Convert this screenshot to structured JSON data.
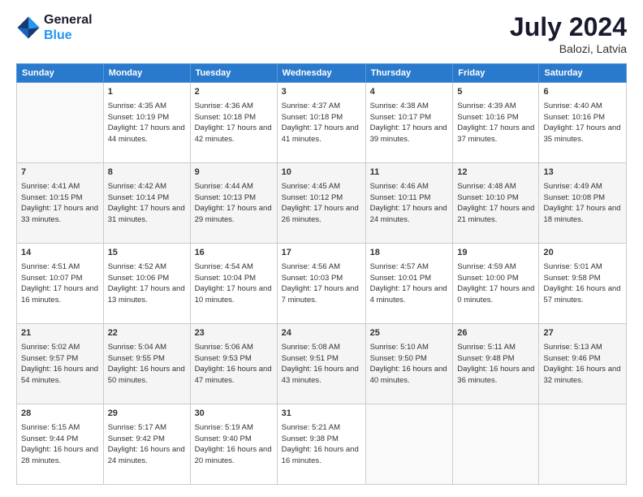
{
  "header": {
    "logo_line1": "General",
    "logo_line2": "Blue",
    "month_title": "July 2024",
    "location": "Balozi, Latvia"
  },
  "days_of_week": [
    "Sunday",
    "Monday",
    "Tuesday",
    "Wednesday",
    "Thursday",
    "Friday",
    "Saturday"
  ],
  "weeks": [
    [
      {
        "day": "",
        "sunrise": "",
        "sunset": "",
        "daylight": ""
      },
      {
        "day": "1",
        "sunrise": "Sunrise: 4:35 AM",
        "sunset": "Sunset: 10:19 PM",
        "daylight": "Daylight: 17 hours and 44 minutes."
      },
      {
        "day": "2",
        "sunrise": "Sunrise: 4:36 AM",
        "sunset": "Sunset: 10:18 PM",
        "daylight": "Daylight: 17 hours and 42 minutes."
      },
      {
        "day": "3",
        "sunrise": "Sunrise: 4:37 AM",
        "sunset": "Sunset: 10:18 PM",
        "daylight": "Daylight: 17 hours and 41 minutes."
      },
      {
        "day": "4",
        "sunrise": "Sunrise: 4:38 AM",
        "sunset": "Sunset: 10:17 PM",
        "daylight": "Daylight: 17 hours and 39 minutes."
      },
      {
        "day": "5",
        "sunrise": "Sunrise: 4:39 AM",
        "sunset": "Sunset: 10:16 PM",
        "daylight": "Daylight: 17 hours and 37 minutes."
      },
      {
        "day": "6",
        "sunrise": "Sunrise: 4:40 AM",
        "sunset": "Sunset: 10:16 PM",
        "daylight": "Daylight: 17 hours and 35 minutes."
      }
    ],
    [
      {
        "day": "7",
        "sunrise": "Sunrise: 4:41 AM",
        "sunset": "Sunset: 10:15 PM",
        "daylight": "Daylight: 17 hours and 33 minutes."
      },
      {
        "day": "8",
        "sunrise": "Sunrise: 4:42 AM",
        "sunset": "Sunset: 10:14 PM",
        "daylight": "Daylight: 17 hours and 31 minutes."
      },
      {
        "day": "9",
        "sunrise": "Sunrise: 4:44 AM",
        "sunset": "Sunset: 10:13 PM",
        "daylight": "Daylight: 17 hours and 29 minutes."
      },
      {
        "day": "10",
        "sunrise": "Sunrise: 4:45 AM",
        "sunset": "Sunset: 10:12 PM",
        "daylight": "Daylight: 17 hours and 26 minutes."
      },
      {
        "day": "11",
        "sunrise": "Sunrise: 4:46 AM",
        "sunset": "Sunset: 10:11 PM",
        "daylight": "Daylight: 17 hours and 24 minutes."
      },
      {
        "day": "12",
        "sunrise": "Sunrise: 4:48 AM",
        "sunset": "Sunset: 10:10 PM",
        "daylight": "Daylight: 17 hours and 21 minutes."
      },
      {
        "day": "13",
        "sunrise": "Sunrise: 4:49 AM",
        "sunset": "Sunset: 10:08 PM",
        "daylight": "Daylight: 17 hours and 18 minutes."
      }
    ],
    [
      {
        "day": "14",
        "sunrise": "Sunrise: 4:51 AM",
        "sunset": "Sunset: 10:07 PM",
        "daylight": "Daylight: 17 hours and 16 minutes."
      },
      {
        "day": "15",
        "sunrise": "Sunrise: 4:52 AM",
        "sunset": "Sunset: 10:06 PM",
        "daylight": "Daylight: 17 hours and 13 minutes."
      },
      {
        "day": "16",
        "sunrise": "Sunrise: 4:54 AM",
        "sunset": "Sunset: 10:04 PM",
        "daylight": "Daylight: 17 hours and 10 minutes."
      },
      {
        "day": "17",
        "sunrise": "Sunrise: 4:56 AM",
        "sunset": "Sunset: 10:03 PM",
        "daylight": "Daylight: 17 hours and 7 minutes."
      },
      {
        "day": "18",
        "sunrise": "Sunrise: 4:57 AM",
        "sunset": "Sunset: 10:01 PM",
        "daylight": "Daylight: 17 hours and 4 minutes."
      },
      {
        "day": "19",
        "sunrise": "Sunrise: 4:59 AM",
        "sunset": "Sunset: 10:00 PM",
        "daylight": "Daylight: 17 hours and 0 minutes."
      },
      {
        "day": "20",
        "sunrise": "Sunrise: 5:01 AM",
        "sunset": "Sunset: 9:58 PM",
        "daylight": "Daylight: 16 hours and 57 minutes."
      }
    ],
    [
      {
        "day": "21",
        "sunrise": "Sunrise: 5:02 AM",
        "sunset": "Sunset: 9:57 PM",
        "daylight": "Daylight: 16 hours and 54 minutes."
      },
      {
        "day": "22",
        "sunrise": "Sunrise: 5:04 AM",
        "sunset": "Sunset: 9:55 PM",
        "daylight": "Daylight: 16 hours and 50 minutes."
      },
      {
        "day": "23",
        "sunrise": "Sunrise: 5:06 AM",
        "sunset": "Sunset: 9:53 PM",
        "daylight": "Daylight: 16 hours and 47 minutes."
      },
      {
        "day": "24",
        "sunrise": "Sunrise: 5:08 AM",
        "sunset": "Sunset: 9:51 PM",
        "daylight": "Daylight: 16 hours and 43 minutes."
      },
      {
        "day": "25",
        "sunrise": "Sunrise: 5:10 AM",
        "sunset": "Sunset: 9:50 PM",
        "daylight": "Daylight: 16 hours and 40 minutes."
      },
      {
        "day": "26",
        "sunrise": "Sunrise: 5:11 AM",
        "sunset": "Sunset: 9:48 PM",
        "daylight": "Daylight: 16 hours and 36 minutes."
      },
      {
        "day": "27",
        "sunrise": "Sunrise: 5:13 AM",
        "sunset": "Sunset: 9:46 PM",
        "daylight": "Daylight: 16 hours and 32 minutes."
      }
    ],
    [
      {
        "day": "28",
        "sunrise": "Sunrise: 5:15 AM",
        "sunset": "Sunset: 9:44 PM",
        "daylight": "Daylight: 16 hours and 28 minutes."
      },
      {
        "day": "29",
        "sunrise": "Sunrise: 5:17 AM",
        "sunset": "Sunset: 9:42 PM",
        "daylight": "Daylight: 16 hours and 24 minutes."
      },
      {
        "day": "30",
        "sunrise": "Sunrise: 5:19 AM",
        "sunset": "Sunset: 9:40 PM",
        "daylight": "Daylight: 16 hours and 20 minutes."
      },
      {
        "day": "31",
        "sunrise": "Sunrise: 5:21 AM",
        "sunset": "Sunset: 9:38 PM",
        "daylight": "Daylight: 16 hours and 16 minutes."
      },
      {
        "day": "",
        "sunrise": "",
        "sunset": "",
        "daylight": ""
      },
      {
        "day": "",
        "sunrise": "",
        "sunset": "",
        "daylight": ""
      },
      {
        "day": "",
        "sunrise": "",
        "sunset": "",
        "daylight": ""
      }
    ]
  ]
}
